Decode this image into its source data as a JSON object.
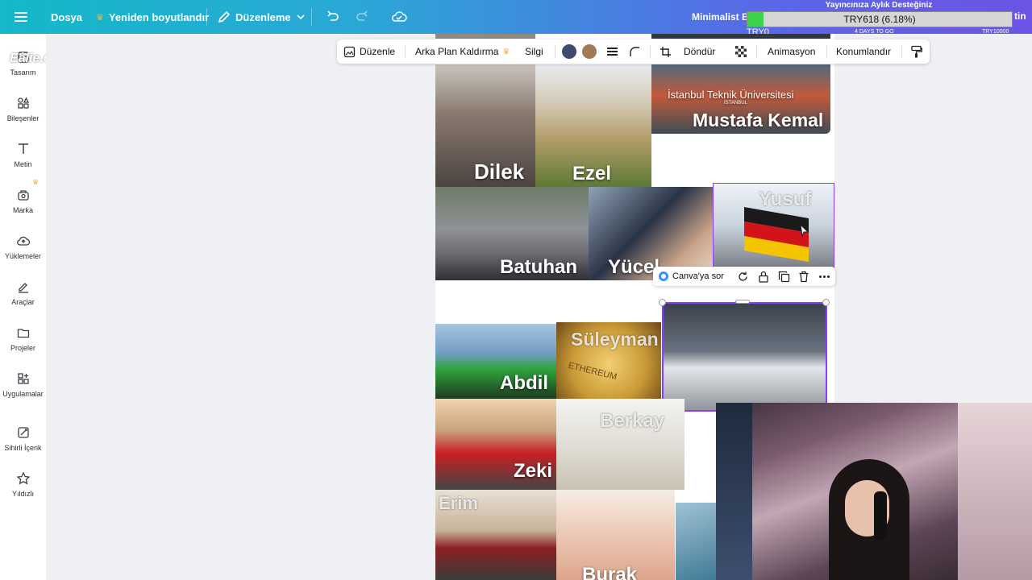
{
  "topbar": {
    "file_label": "Dosya",
    "resize_label": "Yeniden boyutlandır",
    "edit_label": "Düzenleme",
    "doc_title_cut": "Minimalist B",
    "right_cut": "tin"
  },
  "stream_overlay": {
    "title": "Yayıncınıza Aylık Desteğiniz",
    "progress_text": "TRY618 (6.18%)",
    "progress_percent": 6.18,
    "left_label": "TRY0",
    "days_left": "4 DAYS TO GO",
    "goal_label": "TRY10000"
  },
  "sidebar": {
    "watermark": "Eâlie.com",
    "items": [
      {
        "label": "Tasarım",
        "icon": "layout-icon"
      },
      {
        "label": "Bileşenler",
        "icon": "elements-icon"
      },
      {
        "label": "Metin",
        "icon": "text-icon"
      },
      {
        "label": "Marka",
        "icon": "brand-icon"
      },
      {
        "label": "Yüklemeler",
        "icon": "upload-cloud-icon"
      },
      {
        "label": "Araçlar",
        "icon": "draw-tools-icon"
      },
      {
        "label": "Projeler",
        "icon": "folder-icon"
      },
      {
        "label": "Uygulamalar",
        "icon": "apps-icon"
      },
      {
        "label": "Sihirli İçerik",
        "icon": "magic-icon"
      },
      {
        "label": "Yıldızlı",
        "icon": "star-icon"
      }
    ]
  },
  "context_toolbar": {
    "edit": "Düzenle",
    "bg_remove": "Arka Plan Kaldırma",
    "eraser": "Silgi",
    "rotate": "Döndür",
    "animate": "Animasyon",
    "position": "Konumlandır",
    "colors": [
      "#3f4a6e",
      "#a07a5a"
    ]
  },
  "mini_toolbar": {
    "ask_canva": "Canva'ya sor"
  },
  "tiles": {
    "university_text": "İstanbul Teknik Üniversitesi",
    "university_sub": "İSTANBUL",
    "mustafa": "Mustafa Kemal",
    "dilek": "Dilek",
    "ezel": "Ezel",
    "batuhan": "Batuhan",
    "yucel": "Yücel",
    "yusuf": "Yusuf",
    "suleyman": "Süleyman",
    "abdil": "Abdil",
    "ethereum": "ETHEREUM",
    "berkay": "Berkay",
    "zeki": "Zeki",
    "erim": "Erim",
    "burak": "Burak"
  }
}
